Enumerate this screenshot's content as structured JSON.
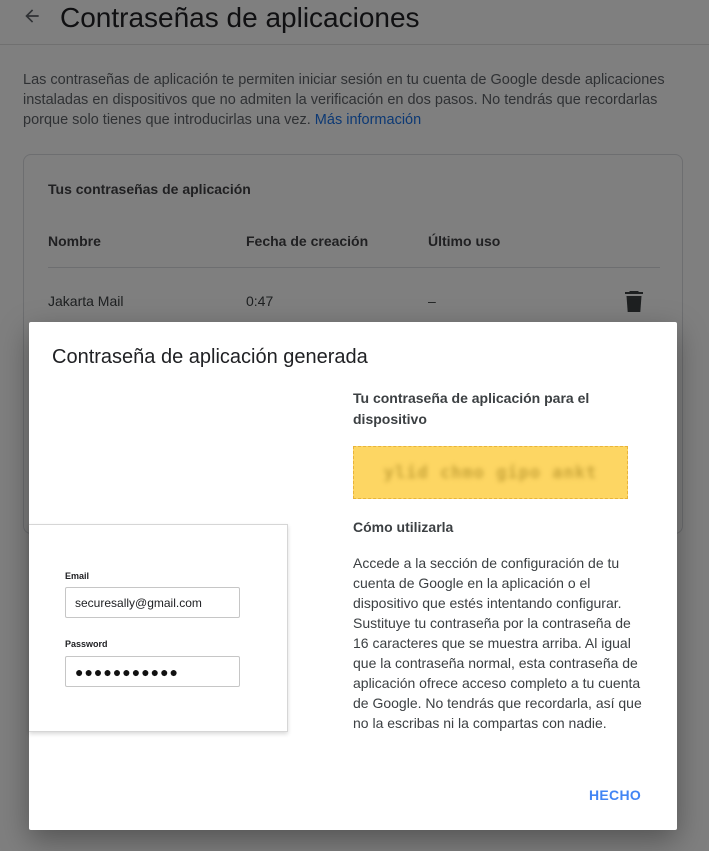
{
  "header": {
    "title": "Contraseñas de aplicaciones",
    "back_icon": "arrow-left-icon"
  },
  "intro": {
    "text": "Las contraseñas de aplicación te permiten iniciar sesión en tu cuenta de Google desde aplicaciones instaladas en dispositivos que no admiten la verificación en dos pasos. No tendrás que recordarlas porque solo tienes que introducirlas una vez.",
    "link": "Más información"
  },
  "card": {
    "title": "Tus contraseñas de aplicación",
    "columns": [
      "Nombre",
      "Fecha de creación",
      "Último uso"
    ],
    "rows": [
      {
        "name": "Jakarta Mail",
        "created": "0:47",
        "last_used": "–",
        "delete_icon": "trash-icon"
      }
    ]
  },
  "dialog": {
    "title": "Contraseña de aplicación generada",
    "illustration": {
      "email_label": "Email",
      "email_value": "securesally@gmail.com",
      "password_label": "Password",
      "password_value": "●●●●●●●●●●●"
    },
    "password_heading": "Tu contraseña de aplicación para el dispositivo",
    "password_value": "ylid chmo gipo ankt",
    "usage_heading": "Cómo utilizarla",
    "usage_text": "Accede a la sección de configuración de tu cuenta de Google en la aplicación o el dispositivo que estés intentando configurar. Sustituye tu contraseña por la contraseña de 16 caracteres que se muestra arriba. Al igual que la contraseña normal, esta contraseña de aplicación ofrece acceso completo a tu cuenta de Google. No tendrás que recordarla, así que no la escribas ni la compartas con nadie.",
    "done_label": "HECHO"
  },
  "colors": {
    "accent": "#4285f4",
    "link": "#1a73e8",
    "password_highlight": "#fdd663"
  }
}
